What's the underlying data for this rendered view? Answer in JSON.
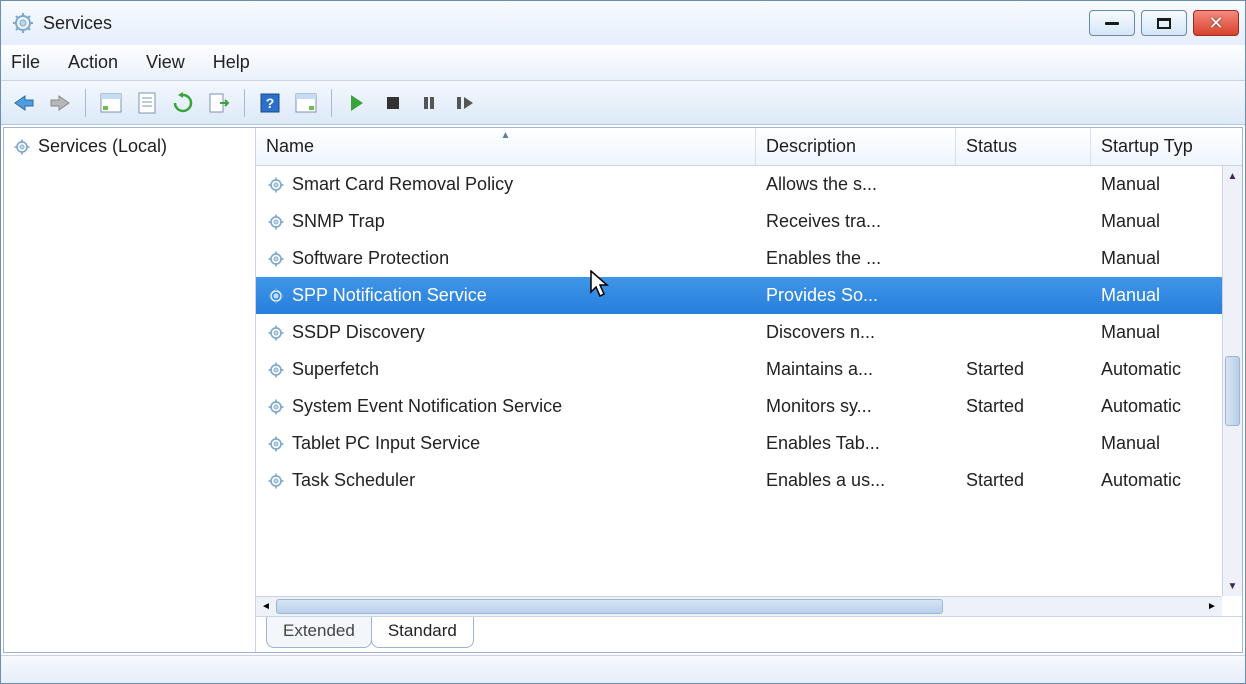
{
  "window": {
    "title": "Services"
  },
  "menus": {
    "file": "File",
    "action": "Action",
    "view": "View",
    "help": "Help"
  },
  "sidebar": {
    "root": "Services (Local)"
  },
  "columns": {
    "name": "Name",
    "description": "Description",
    "status": "Status",
    "startup": "Startup Typ"
  },
  "services": [
    {
      "name": "Smart Card Removal Policy",
      "desc": "Allows the s...",
      "status": "",
      "startup": "Manual"
    },
    {
      "name": "SNMP Trap",
      "desc": "Receives tra...",
      "status": "",
      "startup": "Manual"
    },
    {
      "name": "Software Protection",
      "desc": "Enables the ...",
      "status": "",
      "startup": "Manual"
    },
    {
      "name": "SPP Notification Service",
      "desc": "Provides So...",
      "status": "",
      "startup": "Manual"
    },
    {
      "name": "SSDP Discovery",
      "desc": "Discovers n...",
      "status": "",
      "startup": "Manual"
    },
    {
      "name": "Superfetch",
      "desc": "Maintains a...",
      "status": "Started",
      "startup": "Automatic"
    },
    {
      "name": "System Event Notification Service",
      "desc": "Monitors sy...",
      "status": "Started",
      "startup": "Automatic"
    },
    {
      "name": "Tablet PC Input Service",
      "desc": "Enables Tab...",
      "status": "",
      "startup": "Manual"
    },
    {
      "name": "Task Scheduler",
      "desc": "Enables a us...",
      "status": "Started",
      "startup": "Automatic"
    }
  ],
  "selected_index": 3,
  "tabs": {
    "extended": "Extended",
    "standard": "Standard"
  }
}
